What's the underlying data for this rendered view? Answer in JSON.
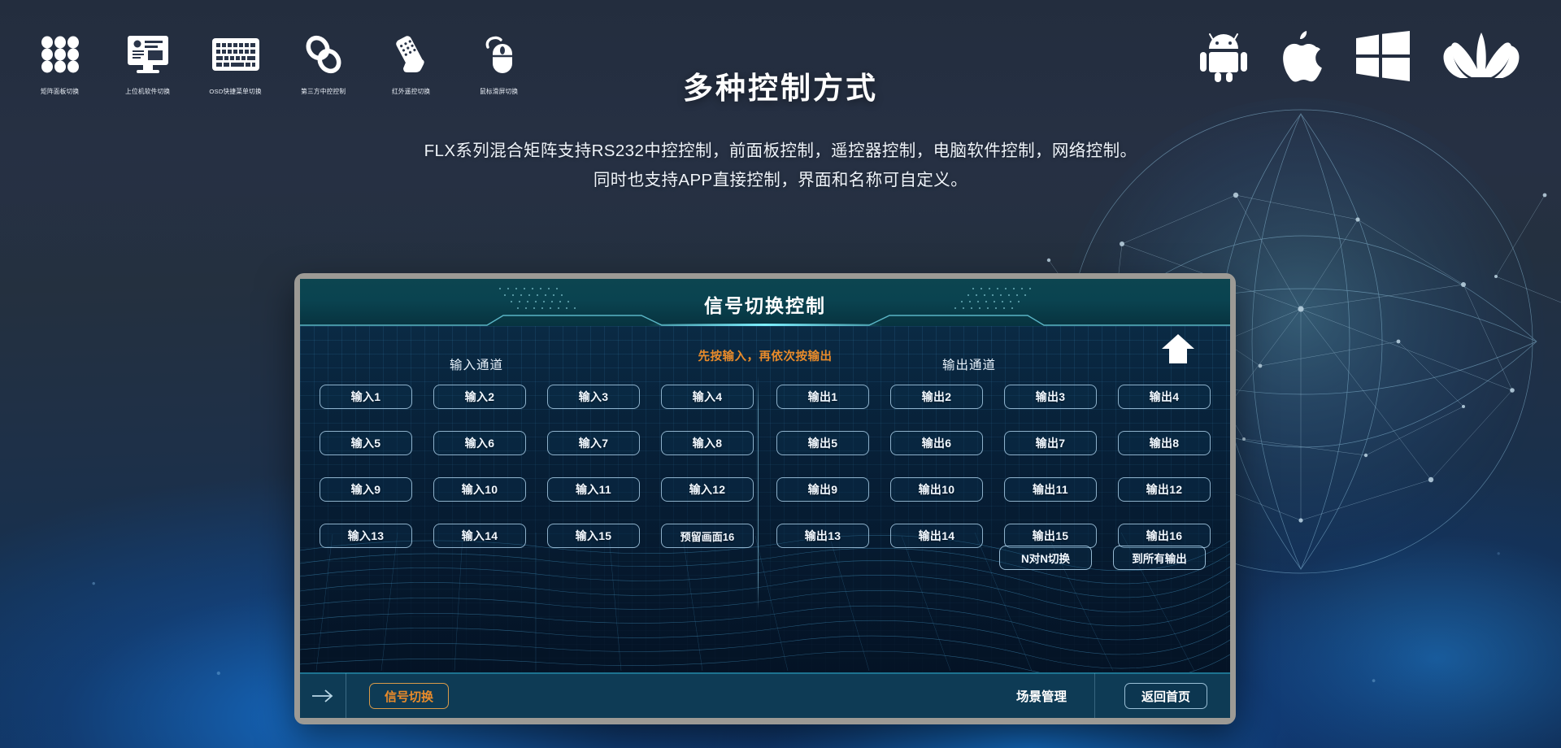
{
  "hero": {
    "title": "多种控制方式",
    "desc_line1": "FLX系列混合矩阵支持RS232中控控制，前面板控制，遥控器控制，电脑软件控制，网络控制。",
    "desc_line2": "同时也支持APP直接控制，界面和名称可自定义。"
  },
  "control_methods": [
    {
      "icon": "matrix-panel-icon",
      "label": "矩阵面板切换"
    },
    {
      "icon": "desktop-monitor-icon",
      "label": "上位机软件切换"
    },
    {
      "icon": "keyboard-icon",
      "label": "OSD快捷菜单切换"
    },
    {
      "icon": "chain-link-icon",
      "label": "第三方中控控制"
    },
    {
      "icon": "remote-control-icon",
      "label": "红外遥控切换"
    },
    {
      "icon": "mouse-icon",
      "label": "鼠标滑屏切换"
    }
  ],
  "os_logos": [
    {
      "icon": "android-logo",
      "name": "Android"
    },
    {
      "icon": "apple-logo",
      "name": "Apple"
    },
    {
      "icon": "windows-logo",
      "name": "Windows"
    },
    {
      "icon": "huawei-logo",
      "name": "Huawei"
    }
  ],
  "panel": {
    "title": "信号切换控制",
    "up_arrow_icon": "up-arrow-icon",
    "input_header": "输入通道",
    "output_header": "输出通道",
    "hint": "先按输入，再依次按输出",
    "inputs": [
      "输入1",
      "输入2",
      "输入3",
      "输入4",
      "输入5",
      "输入6",
      "输入7",
      "输入8",
      "输入9",
      "输入10",
      "输入11",
      "输入12",
      "输入13",
      "输入14",
      "输入15",
      "预留画面16"
    ],
    "outputs": [
      "输出1",
      "输出2",
      "输出3",
      "输出4",
      "输出5",
      "输出6",
      "输出7",
      "输出8",
      "输出9",
      "输出10",
      "输出11",
      "输出12",
      "输出13",
      "输出14",
      "输出15",
      "输出16"
    ],
    "actions": [
      "N对N切换",
      "到所有输出"
    ],
    "footer": {
      "back_arrow_icon": "right-arrow-icon",
      "tab_signal": "信号切换",
      "tab_scene": "场景管理",
      "home_button": "返回首页"
    }
  },
  "colors": {
    "accent_orange": "#e98b2a",
    "panel_bezel": "#9c9a95",
    "header_teal": "#0a4350",
    "footer_blue": "#0e3b55",
    "button_border": "#badff8"
  }
}
